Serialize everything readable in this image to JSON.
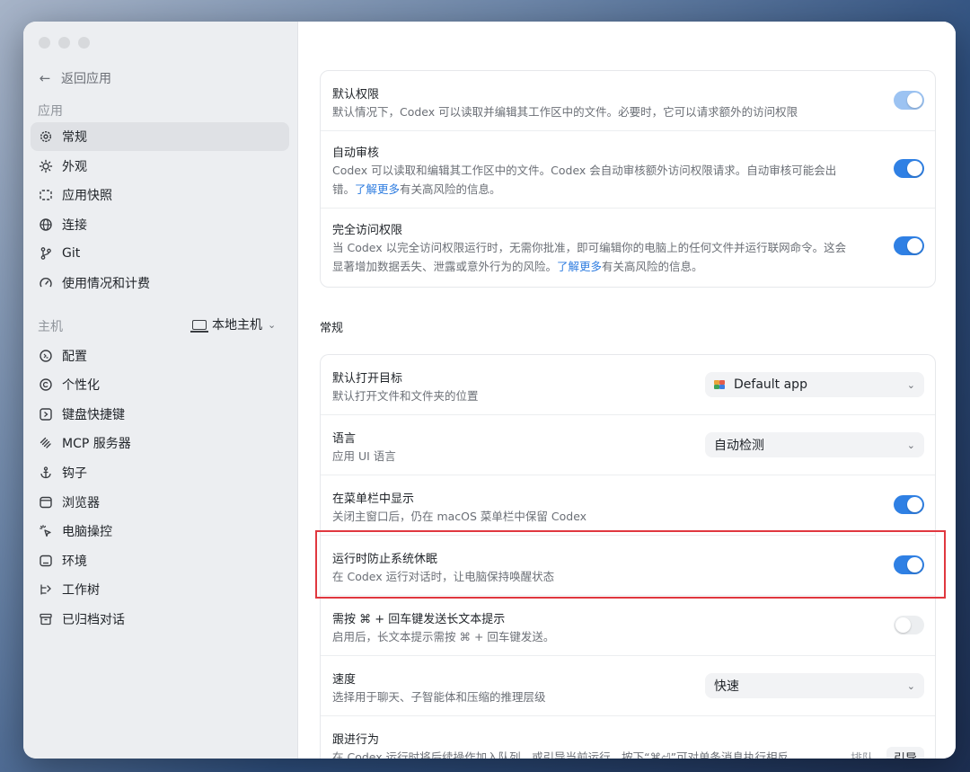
{
  "sidebar": {
    "back_label": "返回应用",
    "app_section": "应用",
    "app_items": [
      {
        "label": "常规",
        "icon": "gear-icon",
        "active": true
      },
      {
        "label": "外观",
        "icon": "sun-icon"
      },
      {
        "label": "应用快照",
        "icon": "snapshot-icon"
      },
      {
        "label": "连接",
        "icon": "globe-icon"
      },
      {
        "label": "Git",
        "icon": "git-branch-icon"
      },
      {
        "label": "使用情况和计费",
        "icon": "gauge-icon"
      }
    ],
    "host_section": "主机",
    "host_selector": "本地主机",
    "host_items": [
      {
        "label": "配置",
        "icon": "config-icon"
      },
      {
        "label": "个性化",
        "icon": "personalize-icon"
      },
      {
        "label": "键盘快捷键",
        "icon": "keyboard-icon"
      },
      {
        "label": "MCP 服务器",
        "icon": "mcp-icon"
      },
      {
        "label": "钩子",
        "icon": "hook-icon"
      },
      {
        "label": "浏览器",
        "icon": "browser-icon"
      },
      {
        "label": "电脑操控",
        "icon": "cursor-icon"
      },
      {
        "label": "环境",
        "icon": "environment-icon"
      },
      {
        "label": "工作树",
        "icon": "worktree-icon"
      },
      {
        "label": "已归档对话",
        "icon": "archive-icon"
      }
    ]
  },
  "permissions": {
    "rows": [
      {
        "title": "默认权限",
        "desc": "默认情况下，Codex 可以读取并编辑其工作区中的文件。必要时，它可以请求额外的访问权限",
        "toggle": "on-light"
      },
      {
        "title": "自动审核",
        "desc_line1": "Codex 可以读取和编辑其工作区中的文件。Codex 会自动审核额外访问权限请求。自动审核可能会出",
        "desc_line2_pre": "错。",
        "link": "了解更多",
        "desc_line2_post": "有关高风险的信息。",
        "toggle": "on"
      },
      {
        "title": "完全访问权限",
        "desc_line1": "当 Codex 以完全访问权限运行时，无需你批准，即可编辑你的电脑上的任何文件并运行联网命令。这会",
        "desc_line2_pre": "显著增加数据丢失、泄露或意外行为的风险。",
        "link": "了解更多",
        "desc_line2_post": "有关高风险的信息。",
        "toggle": "on"
      }
    ]
  },
  "general": {
    "heading": "常规",
    "default_open": {
      "title": "默认打开目标",
      "desc": "默认打开文件和文件夹的位置",
      "value": "Default app"
    },
    "language": {
      "title": "语言",
      "desc": "应用 UI 语言",
      "value": "自动检测"
    },
    "menubar": {
      "title": "在菜单栏中显示",
      "desc": "关闭主窗口后，仍在 macOS 菜单栏中保留 Codex",
      "toggle": "on"
    },
    "prevent_sleep": {
      "title": "运行时防止系统休眠",
      "desc": "在 Codex 运行对话时，让电脑保持唤醒状态",
      "toggle": "on"
    },
    "cmd_enter": {
      "title": "需按 ⌘ + 回车键发送长文本提示",
      "desc": "启用后，长文本提示需按 ⌘ + 回车键发送。",
      "toggle": "off"
    },
    "speed": {
      "title": "速度",
      "desc": "选择用于聊天、子智能体和压缩的推理层级",
      "value": "快速"
    },
    "follow_up": {
      "title": "跟进行为",
      "desc": "在 Codex 运行时将后续操作加入队列，或引导当前运行。按下“⌘⏎”可对单条消息执行相反",
      "options": [
        "排队",
        "引导"
      ],
      "selected": "引导"
    }
  },
  "colors": {
    "accent": "#2f80e4",
    "highlight": "#e0383f",
    "link": "#2f7de0"
  }
}
